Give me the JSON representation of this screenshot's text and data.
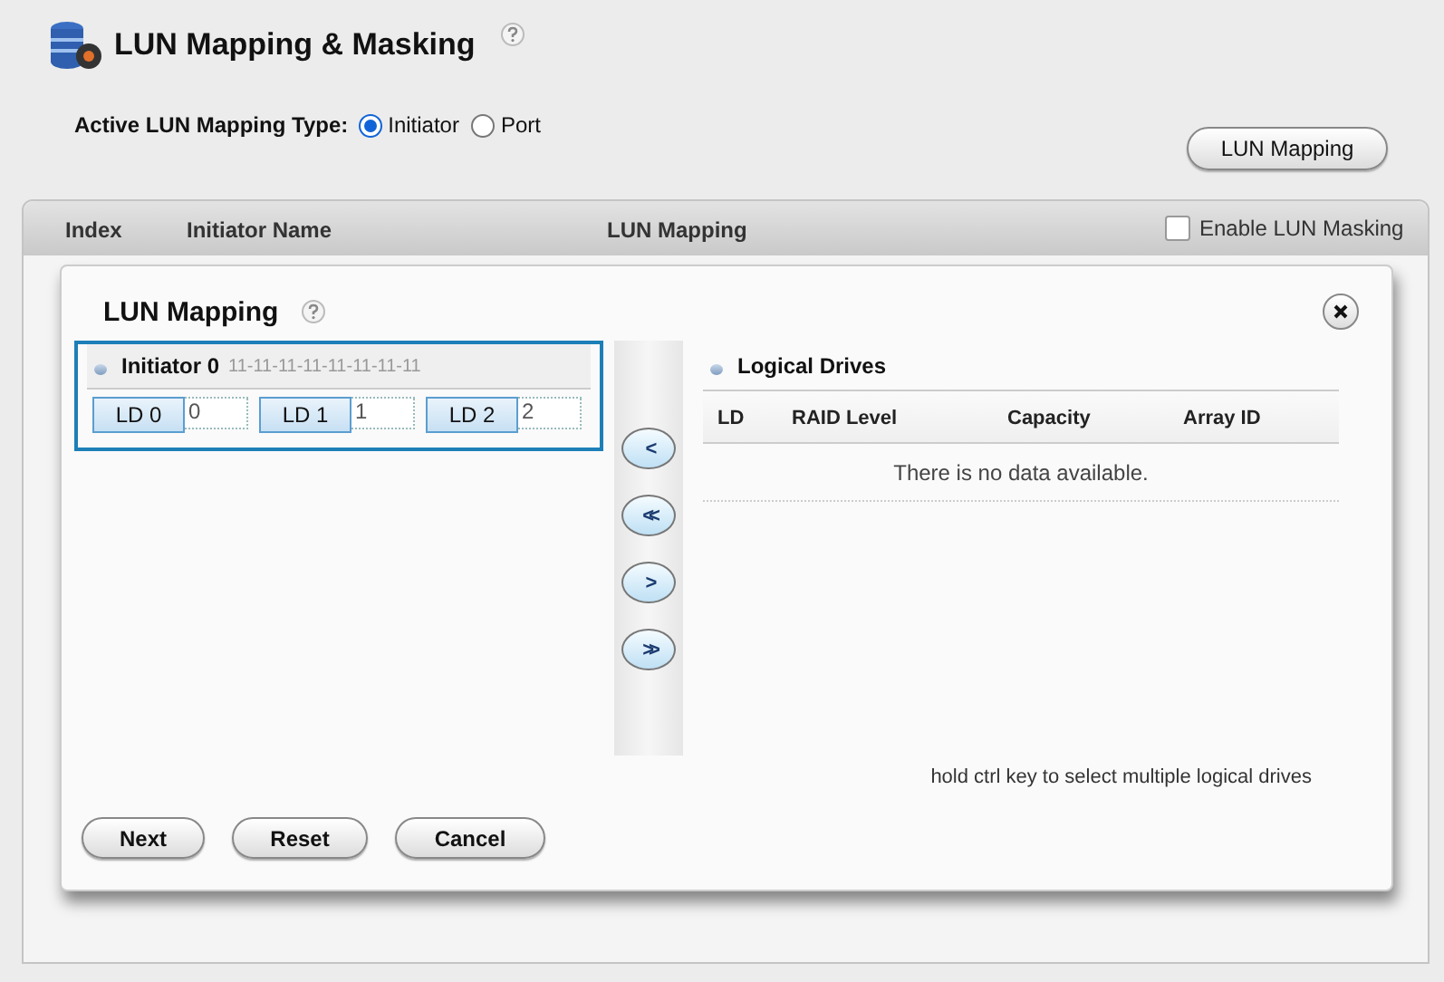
{
  "page": {
    "title": "LUN Mapping & Masking"
  },
  "mapping_type": {
    "label": "Active LUN Mapping Type:",
    "options": [
      {
        "label": "Initiator",
        "selected": true
      },
      {
        "label": "Port",
        "selected": false
      }
    ]
  },
  "lun_mapping_button": "LUN Mapping",
  "table": {
    "columns": [
      "Index",
      "Initiator Name",
      "LUN Mapping"
    ],
    "masking": {
      "label": "Enable LUN Masking",
      "checked": false
    }
  },
  "dialog": {
    "title": "LUN Mapping",
    "initiator": {
      "name": "Initiator 0",
      "id": "11-11-11-11-11-11-11-11",
      "drives": [
        {
          "label": "LD 0",
          "lun": "0"
        },
        {
          "label": "LD 1",
          "lun": "1"
        },
        {
          "label": "LD 2",
          "lun": "2"
        }
      ]
    },
    "move_buttons": [
      "<",
      "<<",
      ">",
      ">>"
    ],
    "logical_drives": {
      "title": "Logical Drives",
      "columns": [
        "LD",
        "RAID Level",
        "Capacity",
        "Array ID"
      ],
      "empty": "There is no data available."
    },
    "hint": "hold ctrl key to select multiple logical drives",
    "buttons": [
      "Next",
      "Reset",
      "Cancel"
    ]
  }
}
